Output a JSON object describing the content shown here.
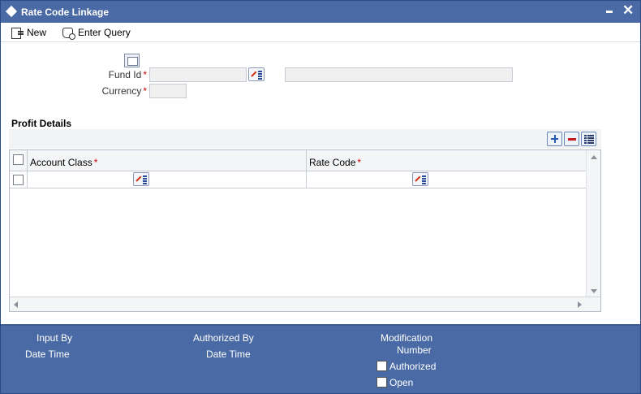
{
  "window": {
    "title": "Rate Code Linkage",
    "minimize_glyph": "",
    "close_glyph": "✕"
  },
  "toolbar": {
    "new_label": "New",
    "enter_query_label": "Enter Query"
  },
  "form": {
    "fund_id_label": "Fund Id",
    "fund_id_value": "",
    "fund_desc_value": "",
    "currency_label": "Currency",
    "currency_value": "",
    "required_mark": "*"
  },
  "profit_details": {
    "title": "Profit Details",
    "columns": [
      {
        "label": "Account Class",
        "required": "*"
      },
      {
        "label": "Rate Code",
        "required": "*"
      }
    ],
    "rows": [
      {
        "account_class": "",
        "rate_code": ""
      }
    ]
  },
  "footer": {
    "input_by_label": "Input By",
    "input_date_time_label": "Date Time",
    "authorized_by_label": "Authorized By",
    "auth_date_time_label": "Date Time",
    "modification_label": "Modification",
    "number_label": "Number",
    "authorized_label": "Authorized",
    "open_label": "Open"
  },
  "colors": {
    "title_bar": "#4a6aa5",
    "required": "#cc0000",
    "lov_arrow": "#d03010"
  }
}
